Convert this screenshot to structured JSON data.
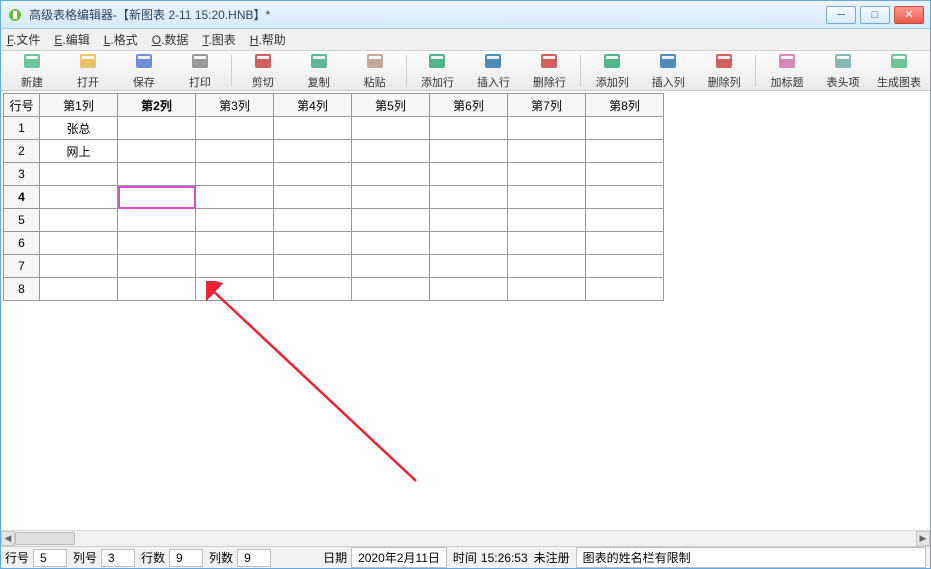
{
  "window": {
    "title": "高级表格编辑器-【新图表 2-11 15:20.HNB】*"
  },
  "menu": {
    "items": [
      {
        "ul": "F",
        "label": ".文件"
      },
      {
        "ul": "E",
        "label": ".编辑"
      },
      {
        "ul": "L",
        "label": ".格式"
      },
      {
        "ul": "O",
        "label": ".数据"
      },
      {
        "ul": "T",
        "label": ".图表"
      },
      {
        "ul": "H",
        "label": ".帮助"
      }
    ]
  },
  "toolbar": {
    "groups": [
      [
        "new",
        "open",
        "save",
        "print"
      ],
      [
        "cut",
        "copy",
        "paste"
      ],
      [
        "add_row",
        "insert_row",
        "delete_row"
      ],
      [
        "add_col",
        "insert_col",
        "delete_col"
      ],
      [
        "add_title",
        "header",
        "gen_chart"
      ]
    ],
    "buttons": {
      "new": "新建",
      "open": "打开",
      "save": "保存",
      "print": "打印",
      "cut": "剪切",
      "copy": "复制",
      "paste": "粘贴",
      "add_row": "添加行",
      "insert_row": "插入行",
      "delete_row": "删除行",
      "add_col": "添加列",
      "insert_col": "插入列",
      "delete_col": "删除列",
      "add_title": "加标题",
      "header": "表头项",
      "gen_chart": "生成图表"
    }
  },
  "table": {
    "row_header": "行号",
    "columns": [
      "第1列",
      "第2列",
      "第3列",
      "第4列",
      "第5列",
      "第6列",
      "第7列",
      "第8列"
    ],
    "rows": [
      {
        "num": "1",
        "cells": [
          "张总",
          "",
          "",
          "",
          "",
          "",
          "",
          ""
        ]
      },
      {
        "num": "2",
        "cells": [
          "网上",
          "",
          "",
          "",
          "",
          "",
          "",
          ""
        ]
      },
      {
        "num": "3",
        "cells": [
          "",
          "",
          "",
          "",
          "",
          "",
          "",
          ""
        ]
      },
      {
        "num": "4",
        "cells": [
          "",
          "",
          "",
          "",
          "",
          "",
          "",
          ""
        ]
      },
      {
        "num": "5",
        "cells": [
          "",
          "",
          "",
          "",
          "",
          "",
          "",
          ""
        ]
      },
      {
        "num": "6",
        "cells": [
          "",
          "",
          "",
          "",
          "",
          "",
          "",
          ""
        ]
      },
      {
        "num": "7",
        "cells": [
          "",
          "",
          "",
          "",
          "",
          "",
          "",
          ""
        ]
      },
      {
        "num": "8",
        "cells": [
          "",
          "",
          "",
          "",
          "",
          "",
          "",
          ""
        ]
      }
    ],
    "active_col_index": 1,
    "active_row_index": 3
  },
  "status": {
    "row_label": "行号",
    "row_value": "5",
    "col_label": "列号",
    "col_value": "3",
    "rows_label": "行数",
    "rows_value": "9",
    "cols_label": "列数",
    "cols_value": "9",
    "date_label": "日期",
    "date_value": "2020年2月11日",
    "time_label": "时间",
    "time_value": "15:26:53",
    "reg": "未注册",
    "note": "图表的姓名栏有限制"
  }
}
